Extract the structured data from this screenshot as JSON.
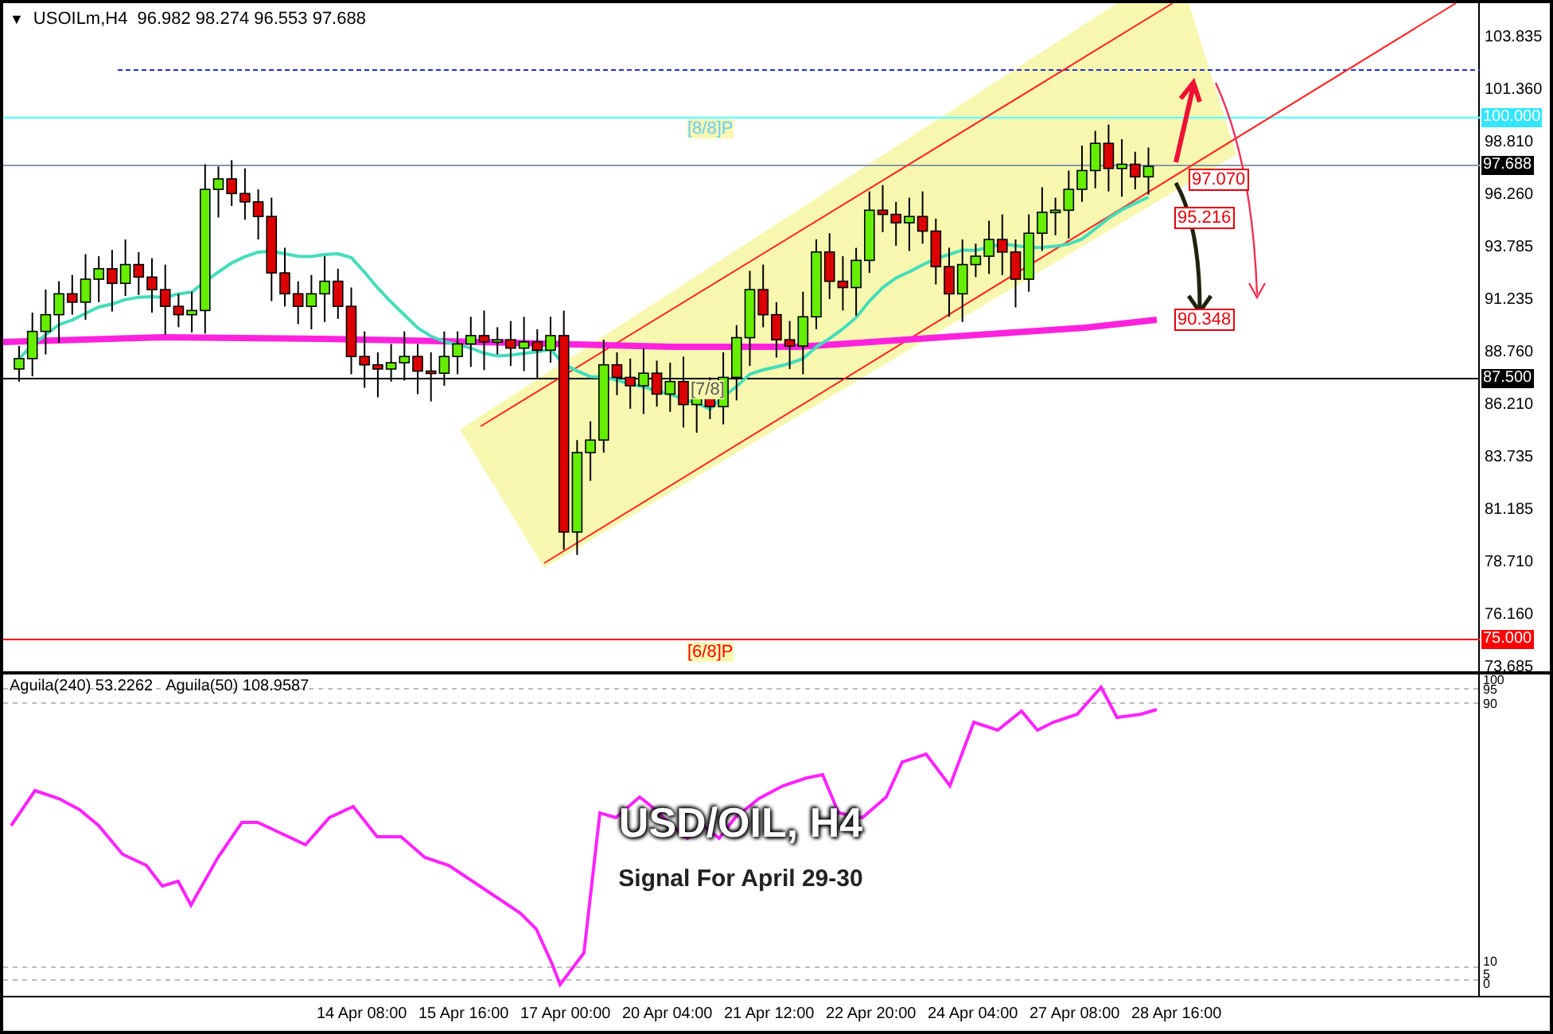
{
  "header": {
    "toggle": "▼",
    "symbol": "USOILm,H4",
    "ohlc": "96.982 98.274 96.553 97.688"
  },
  "price_ticks": [
    "103.835",
    "101.360",
    "98.810",
    "96.260",
    "93.785",
    "91.235",
    "88.760",
    "86.210",
    "83.735",
    "81.185",
    "78.710",
    "76.160",
    "73.685"
  ],
  "price_markers": [
    {
      "label": "100.000",
      "color": "#33e6ff"
    },
    {
      "label": "97.688",
      "color": "#000000"
    },
    {
      "label": "87.500",
      "color": "#000000"
    },
    {
      "label": "75.000",
      "color": "#ff0000"
    }
  ],
  "level_labels": [
    {
      "label": "[8/8]P",
      "color": "#66ccff"
    },
    {
      "label": "[7/8]",
      "color": "#555555"
    },
    {
      "label": "[6/8]P",
      "color": "#ff0000"
    }
  ],
  "price_tags": [
    "97.070",
    "95.216",
    "90.348"
  ],
  "indicator": {
    "legend": [
      "Aguila(240) 53.2262",
      "Aguila(50) 108.9587"
    ],
    "axis": [
      "100",
      "95",
      "90",
      "10",
      "5",
      "0"
    ]
  },
  "time_axis": [
    "14 Apr 08:00",
    "15 Apr 16:00",
    "17 Apr 00:00",
    "20 Apr 04:00",
    "21 Apr 12:00",
    "22 Apr 20:00",
    "24 Apr 04:00",
    "27 Apr 08:00",
    "28 Apr 16:00"
  ],
  "overlay": {
    "title": "USD/OIL, H4",
    "subtitle": "Signal For April 29-30"
  }
}
